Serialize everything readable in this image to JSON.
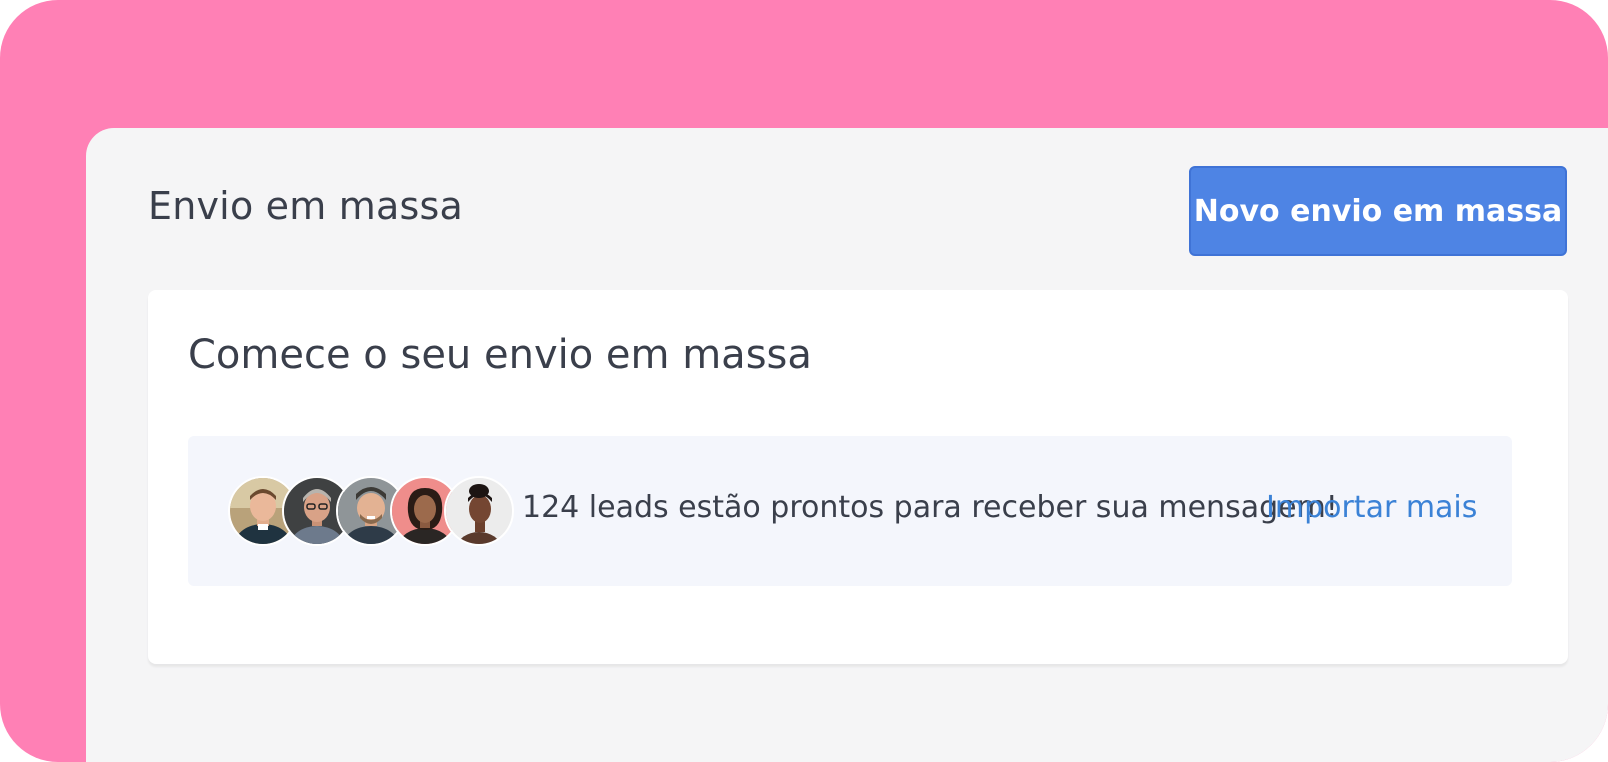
{
  "header": {
    "title": "Envio em massa",
    "new_button_label": "Novo envio em massa"
  },
  "card": {
    "title": "Comece o seu envio em massa",
    "leads_message": "124 leads estão prontos para receber sua mensagem!",
    "import_link_label": "Importar mais",
    "avatars": [
      {
        "name": "avatar-1"
      },
      {
        "name": "avatar-2"
      },
      {
        "name": "avatar-3"
      },
      {
        "name": "avatar-4"
      },
      {
        "name": "avatar-5"
      }
    ]
  },
  "colors": {
    "frame_background": "#ff80b5",
    "panel_background": "#f5f5f6",
    "primary_button": "#4e84e4",
    "link": "#3b82d6",
    "leads_box_background": "#f4f6fc",
    "text": "#3a3f4b"
  }
}
